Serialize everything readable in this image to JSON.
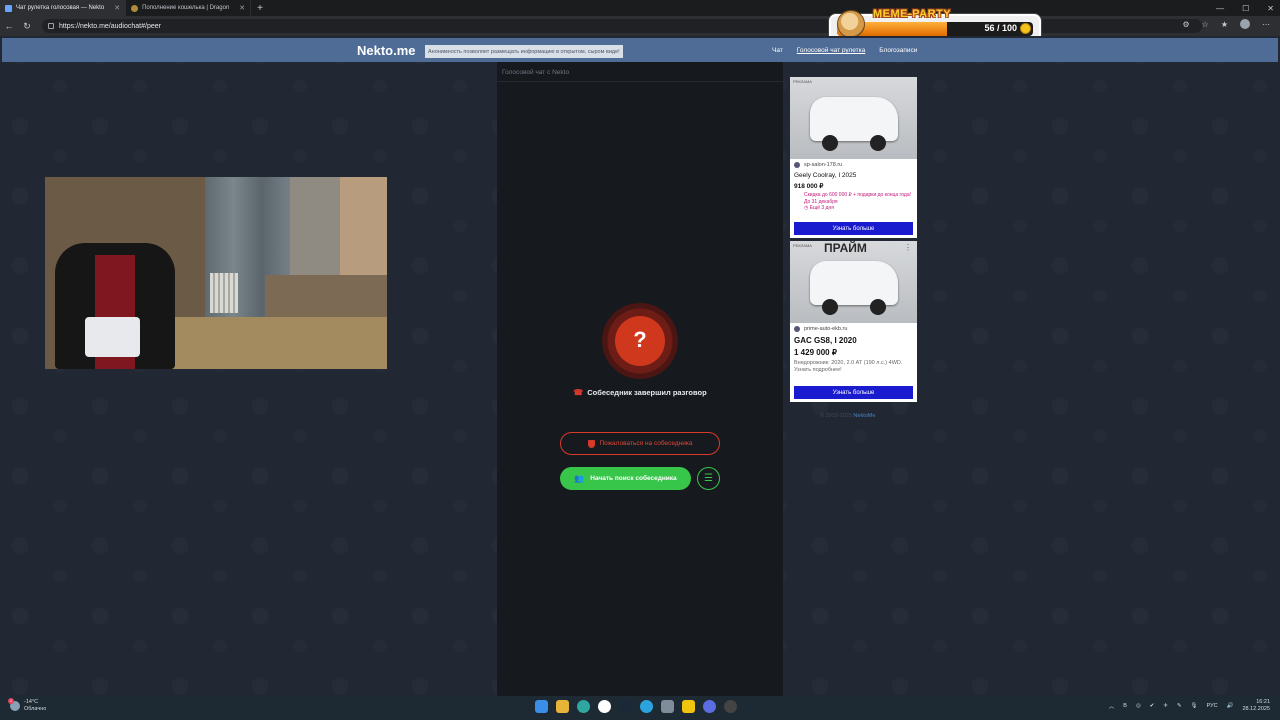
{
  "browser": {
    "tabs": [
      {
        "title": "Чат рулетка голосовая — Nekto",
        "active": true
      },
      {
        "title": "Пополнение кошелька | Dragon",
        "active": false
      }
    ],
    "new_tab": "+",
    "url": "https://nekto.me/audiochat#/peer",
    "window_controls": {
      "minimize": "—",
      "maximize": "☐",
      "close": "✕"
    }
  },
  "overlay": {
    "title": "MEME-PARTY",
    "progress_text": "56 / 100",
    "progress_fraction": 0.56
  },
  "site": {
    "logo": "Nekto.me",
    "notice": "Анонимность позволяет размещать информацию в открытом, сыром виде!",
    "menu": [
      {
        "label": "Чат",
        "active": false
      },
      {
        "label": "Голосовой чат рулетка",
        "active": true
      },
      {
        "label": "Блогозаписи",
        "active": false
      }
    ]
  },
  "chat": {
    "header": "Голосовой чат с Nekto",
    "status_icon": "?",
    "status_text": "Собеседник завершил разговор",
    "report_label": "Пожаловаться на собеседника",
    "search_label": "Начать поиск собеседника"
  },
  "ads": [
    {
      "label": "РЕКЛАМА",
      "domain": "sp-salon-178.ru",
      "title": "Geely Coolray, I 2025",
      "price": "918 000 ₽",
      "promo": "Скидка до 600 000 ₽ + подарки до конца года! До 31 декабря",
      "promo_timer": "Ещё 3 дня",
      "cta": "Узнать больше"
    },
    {
      "label": "РЕКЛАМА",
      "brand": "ПРАЙМ",
      "domain": "prime-auto-ekb.ru",
      "title": "GAC GS8, I 2020",
      "price": "1 429 000 ₽",
      "desc": "Внедорожник: 2020, 2.0 AT (190 л.с.) 4WD. Узнать подробнее!",
      "cta": "Узнать больше"
    }
  ],
  "footer": {
    "copyright": "© 2012-2025",
    "link": "NektoMe"
  },
  "taskbar": {
    "temp": "-14°C",
    "weather": "Облачно",
    "lang": "РУС",
    "time": "16:21",
    "date": "28.12.2025"
  }
}
